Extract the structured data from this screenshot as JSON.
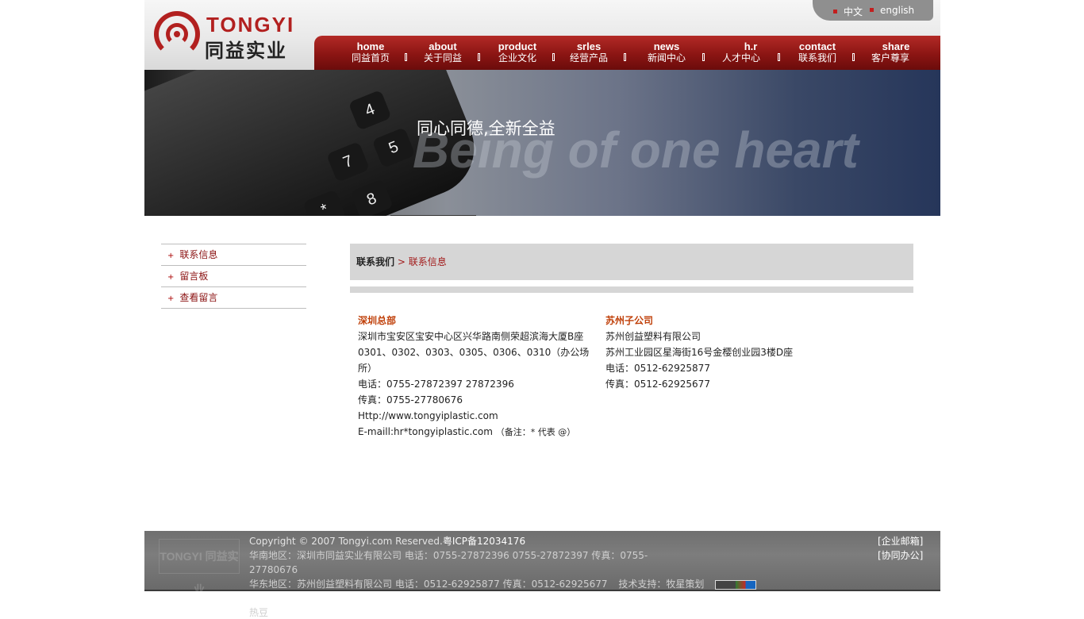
{
  "header": {
    "logo_en": "TONGYI",
    "logo_cn": "同益实业",
    "lang": [
      {
        "label": "中文"
      },
      {
        "label": "english"
      }
    ],
    "nav": [
      {
        "en": "home",
        "cn": "同益首页"
      },
      {
        "en": "about",
        "cn": "关于同益"
      },
      {
        "en": "product",
        "cn": "企业文化"
      },
      {
        "en": "srles",
        "cn": "经营产品"
      },
      {
        "en": "news",
        "cn": "新闻中心"
      },
      {
        "en": "h.r",
        "cn": "人才中心"
      },
      {
        "en": "contact",
        "cn": "联系我们"
      },
      {
        "en": "share",
        "cn": "客户尊享"
      }
    ]
  },
  "banner": {
    "title": "同心同德,全新全益",
    "motto": "Being of one heart",
    "keys": [
      "4",
      "7",
      "5",
      "8",
      "*"
    ]
  },
  "sidebar": {
    "items": [
      {
        "label": "联系信息"
      },
      {
        "label": "留言板"
      },
      {
        "label": "查看留言"
      }
    ]
  },
  "breadcrumb": {
    "root": "联系我们",
    "sep": " > ",
    "current": "联系信息"
  },
  "contacts": {
    "hq": {
      "title": "深圳总部",
      "address": "深圳市宝安区宝安中心区兴华路南侧荣超滨海大厦B座0301、0302、0303、0305、0306、0310（办公场所）",
      "phone": "电话：0755-27872397 27872396",
      "fax": "传真：0755-27780676",
      "web": "Http://www.tongyiplastic.com",
      "email_prefix": "E-maill:",
      "email": "hr*tongyiplastic.com",
      "email_note": "（备注：* 代表 @）"
    },
    "suzhou": {
      "title": "苏州子公司",
      "company": "苏州创益塑料有限公司",
      "address": "苏州工业园区星海街16号金樱创业园3楼D座",
      "phone": "电话：0512-62925877",
      "fax": "传真：0512-62925677"
    }
  },
  "footer": {
    "logo_text": "TONGYI 同益实业",
    "copyright": "Copyright © 2007 Tongyi.com Reserved.",
    "icp": "粤ICP备12034176",
    "south": "华南地区：深圳市同益实业有限公司 电话：0755-27872396 0755-27872397 传真：0755-27780676",
    "east": "华东地区：苏州创益塑料有限公司 电话：0512-62925877 传真：0512-62925677",
    "support": "技术支持：牧星策划",
    "links": [
      "[企业邮箱]",
      "[协同办公]"
    ],
    "extra": "热豆"
  },
  "colors": {
    "brand_red": "#b2201f",
    "nav_red": "#8b1513",
    "title_orange": "#c0410b",
    "crumb_red": "#a21b1b"
  }
}
